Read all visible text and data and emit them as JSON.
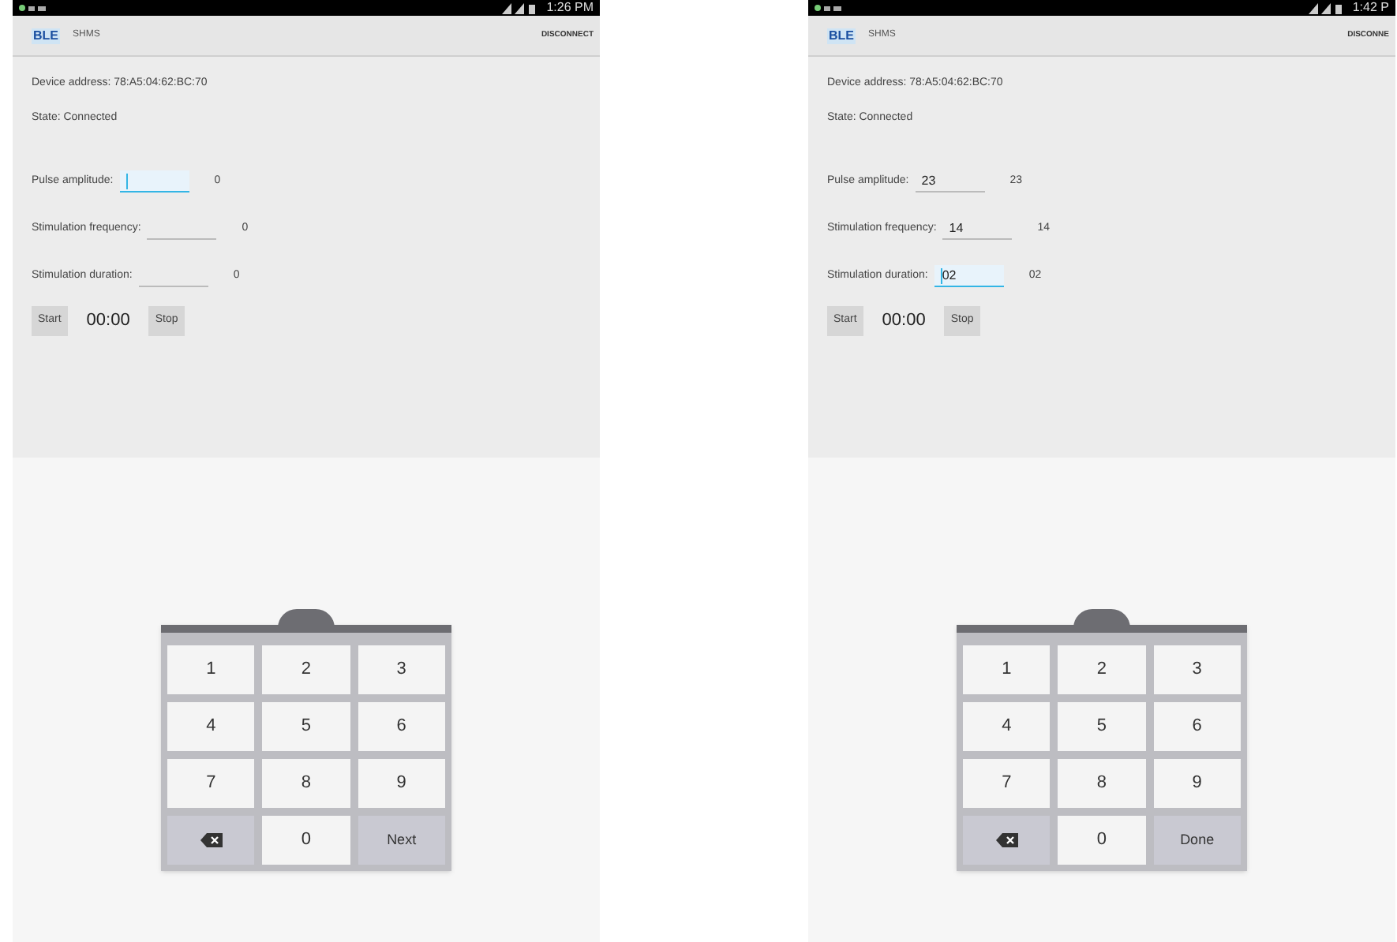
{
  "screens": [
    {
      "status_time": "1:26 PM",
      "app_logo": "BLE",
      "app_title": "SHMS",
      "action": "DISCONNECT",
      "device_address": "Device address: 78:A5:04:62:BC:70",
      "state": "State: Connected",
      "fields": [
        {
          "label": "Pulse amplitude:",
          "reading": "0",
          "focused": true
        },
        {
          "label": "Stimulation frequency:",
          "reading": "0",
          "focused": false
        },
        {
          "label": "Stimulation duration:",
          "reading": "0",
          "focused": false
        }
      ],
      "start": "Start",
      "timer": "00:00",
      "stop": "Stop",
      "keys": [
        {
          "label": "1",
          "kind": "digit"
        },
        {
          "label": "2",
          "kind": "digit"
        },
        {
          "label": "3",
          "kind": "digit"
        },
        {
          "label": "4",
          "kind": "digit"
        },
        {
          "label": "5",
          "kind": "digit"
        },
        {
          "label": "6",
          "kind": "digit"
        },
        {
          "label": "7",
          "kind": "digit"
        },
        {
          "label": "8",
          "kind": "digit"
        },
        {
          "label": "9",
          "kind": "digit"
        },
        {
          "kind": "backspace"
        },
        {
          "label": "0",
          "kind": "digit"
        },
        {
          "label": "Next",
          "kind": "action"
        }
      ]
    },
    {
      "status_time": "1:42 P",
      "app_logo": "BLE",
      "app_title": "SHMS",
      "action": "DISCONNE",
      "device_address": "Device address: 78:A5:04:62:BC:70",
      "state": "State: Connected",
      "fields": [
        {
          "label": "Pulse amplitude:",
          "value": "23",
          "reading": "23",
          "focused": false
        },
        {
          "label": "Stimulation frequency:",
          "value": "14",
          "reading": "14",
          "focused": false
        },
        {
          "label": "Stimulation duration:",
          "value": "02",
          "reading": "02",
          "focused": true
        }
      ],
      "start": "Start",
      "timer": "00:00",
      "stop": "Stop",
      "keys": [
        {
          "label": "1",
          "kind": "digit"
        },
        {
          "label": "2",
          "kind": "digit"
        },
        {
          "label": "3",
          "kind": "digit"
        },
        {
          "label": "4",
          "kind": "digit"
        },
        {
          "label": "5",
          "kind": "digit"
        },
        {
          "label": "6",
          "kind": "digit"
        },
        {
          "label": "7",
          "kind": "digit"
        },
        {
          "label": "8",
          "kind": "digit"
        },
        {
          "label": "9",
          "kind": "digit"
        },
        {
          "kind": "backspace"
        },
        {
          "label": "0",
          "kind": "digit"
        },
        {
          "label": "Done",
          "kind": "action"
        }
      ]
    }
  ]
}
